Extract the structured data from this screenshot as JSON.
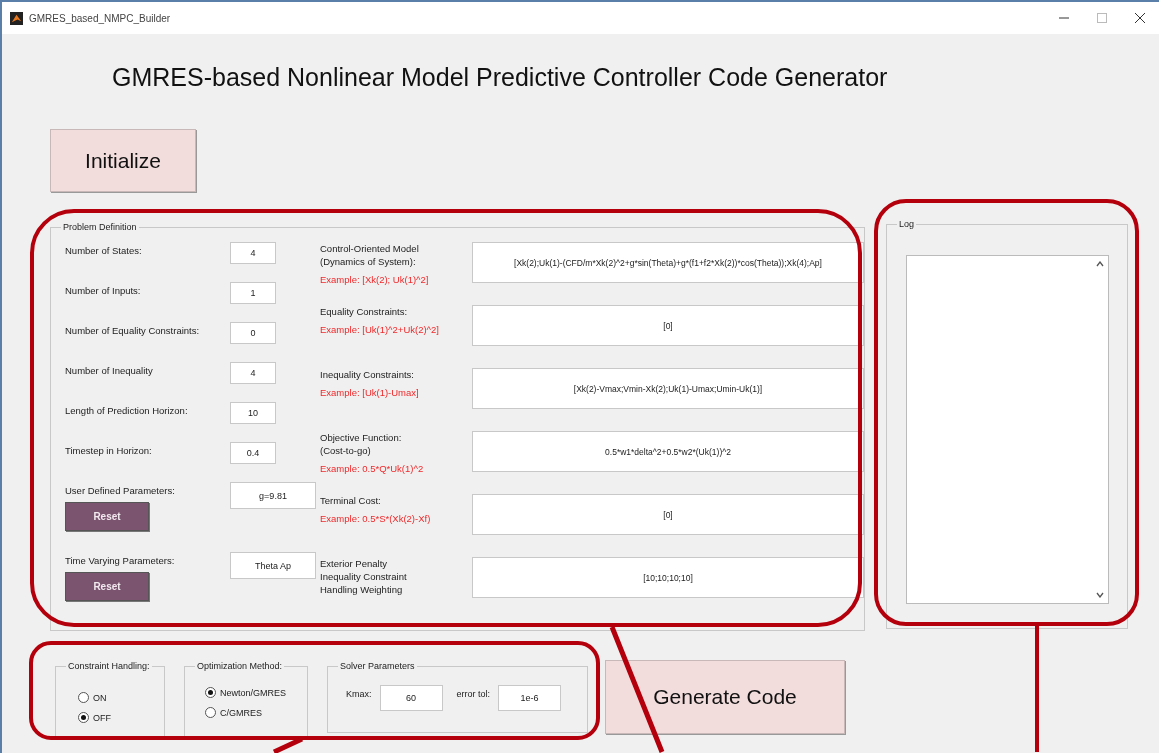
{
  "window": {
    "title": "GMRES_based_NMPC_Builder"
  },
  "heading": "GMRES-based Nonlinear Model Predictive Controller Code Generator",
  "initialize_button": "Initialize",
  "problem_definition": {
    "title": "Problem Definition",
    "settings": [
      {
        "label": "Number of States:",
        "value": "4"
      },
      {
        "label": "Number of Inputs:",
        "value": "1"
      },
      {
        "label": "Number of Equality Constraints:",
        "value": "0"
      },
      {
        "label": "Number of Inequality",
        "value": "4"
      },
      {
        "label": "Length of Prediction Horizon:",
        "value": "10"
      },
      {
        "label": "Timestep in Horizon:",
        "value": "0.4"
      },
      {
        "label": "User Defined Parameters:",
        "value": "g=9.81",
        "button": "Reset"
      },
      {
        "label": "Time Varying Parameters:",
        "value": "Theta Ap",
        "button": "Reset"
      }
    ],
    "expressions": [
      {
        "label": "Control-Oriented Model\n(Dynamics of System):",
        "example": "Example: [Xk(2); Uk(1)^2]",
        "value": "[Xk(2);Uk(1)-(CFD/m*Xk(2)^2+g*sin(Theta)+g*(f1+f2*Xk(2))*cos(Theta));Xk(4);Ap]"
      },
      {
        "label": "Equality Constraints:",
        "example": "Example: [Uk(1)^2+Uk(2)^2]",
        "value": "[0]"
      },
      {
        "label": "Inequality Constraints:",
        "example": "Example: [Uk(1)-Umax]",
        "value": "[Xk(2)-Vmax;Vmin-Xk(2);Uk(1)-Umax;Umin-Uk(1)]"
      },
      {
        "label": "Objective Function:\n(Cost-to-go)",
        "example": "Example: 0.5*Q*Uk(1)^2",
        "value": "0.5*w1*delta^2+0.5*w2*(Uk(1))^2"
      },
      {
        "label": "Terminal Cost:",
        "example": "Example: 0.5*S*(Xk(2)-Xf)",
        "value": "[0]"
      },
      {
        "label": "Exterior Penalty\nInequality Constraint\nHandling Weighting",
        "value": "[10;10;10;10]"
      }
    ]
  },
  "log": {
    "title": "Log"
  },
  "constraint_handling": {
    "title": "Constraint Handling:",
    "options": [
      {
        "label": "ON",
        "selected": false
      },
      {
        "label": "OFF",
        "selected": true
      }
    ]
  },
  "optimization_method": {
    "title": "Optimization Method:",
    "options": [
      {
        "label": "Newton/GMRES",
        "selected": true
      },
      {
        "label": "C/GMRES",
        "selected": false
      }
    ]
  },
  "solver_parameters": {
    "title": "Solver Parameters",
    "fields": [
      {
        "label": "Kmax:",
        "value": "60"
      },
      {
        "label": "error tol:",
        "value": "1e-6"
      }
    ]
  },
  "generate_button": "Generate Code"
}
